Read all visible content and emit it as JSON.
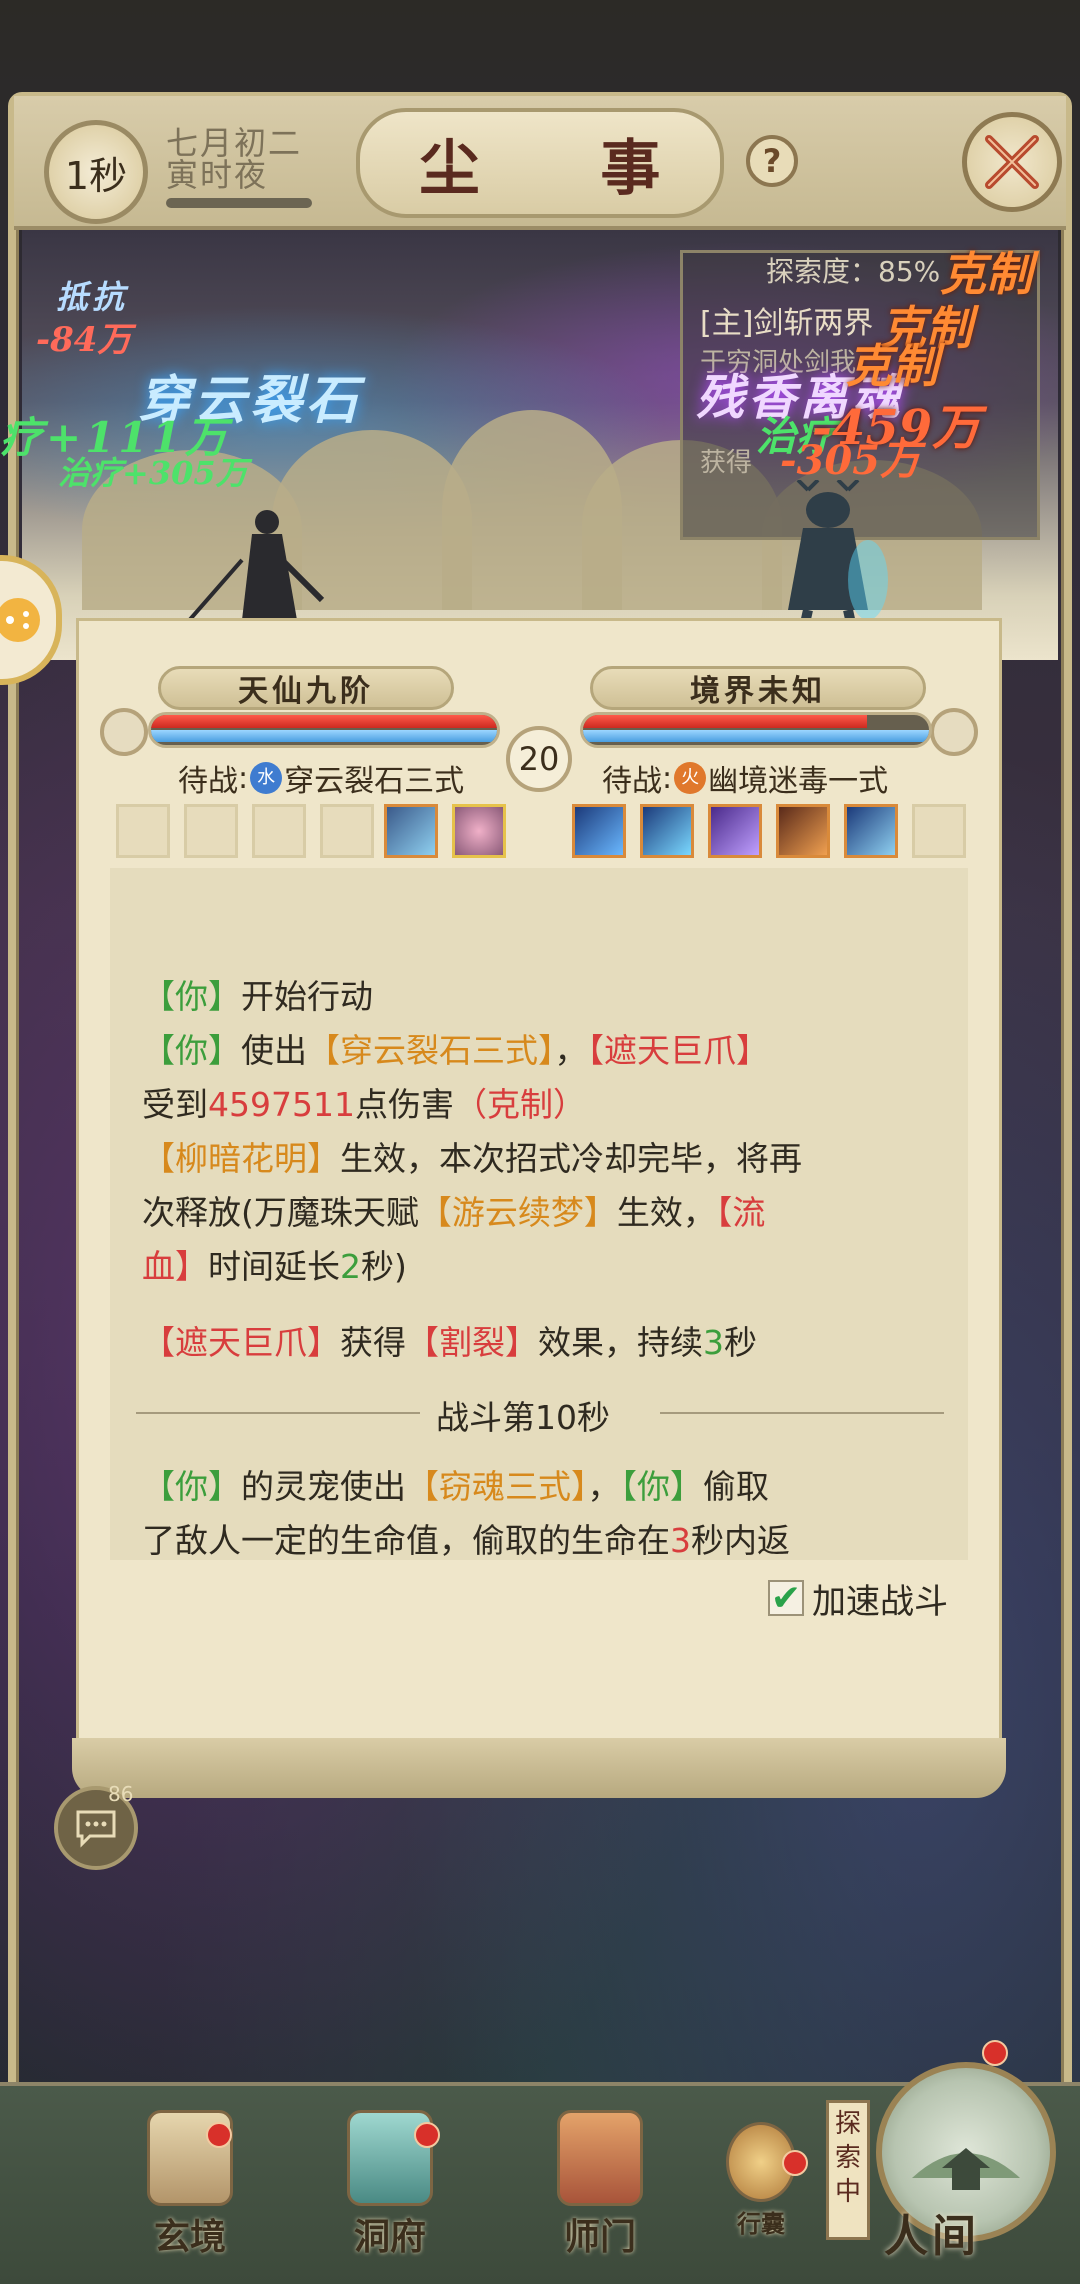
{
  "header": {
    "time_badge": "1秒",
    "date_line1": "七月初二",
    "date_line2": "寅时夜",
    "title": "尘 事",
    "help_label": "?"
  },
  "explore": {
    "progress": "探索度：85%",
    "line1": "[主]剑斩两界",
    "line2": "于穷洞处剑我",
    "line3": "获得"
  },
  "combat_text": {
    "resist_label": "抵抗",
    "resist_value": "-84万",
    "heal_big": "疗+111万",
    "heal_small": "治疗+305万",
    "skill_left": "穿云裂石",
    "skill_right": "残香离魂",
    "counter_1": "克制",
    "counter_2": "克制",
    "counter_3": "克制",
    "dmg_right": "-459万",
    "heal_right": "治疗",
    "heal_right2": "-305万"
  },
  "player": {
    "name": "天仙九阶",
    "hp": 1.0,
    "mp": 1.0,
    "pending_label": "待战",
    "element": "水",
    "pending_skill": "穿云裂石三式"
  },
  "enemy": {
    "name": "境界未知",
    "hp": 0.82,
    "mp": 1.0,
    "pending_label": "待战",
    "element": "火",
    "pending_skill": "幽境迷毒一式"
  },
  "turn_counter": "20",
  "log": {
    "l1_a": "【你】",
    "l1_b": "开始行动",
    "l2_a": "【你】",
    "l2_b": "使出",
    "l2_c": "【穿云裂石三式】",
    "l2_d": "，",
    "l2_e": "【遮天巨爪】",
    "l3_a": "受到",
    "l3_b": "4597511",
    "l3_c": "点伤害",
    "l3_d": "（克制）",
    "l4_a": "【柳暗花明】",
    "l4_b": "生效，本次招式冷却完毕，将再",
    "l5_a": "次释放(万魔珠天赋",
    "l5_b": "【游云续梦】",
    "l5_c": "生效，",
    "l5_d": "【流",
    "l6_a": "血】",
    "l6_b": "时间延长",
    "l6_c": "2",
    "l6_d": "秒)",
    "l7_a": "【遮天巨爪】",
    "l7_b": "获得",
    "l7_c": "【割裂】",
    "l7_d": "效果，持续",
    "l7_e": "3",
    "l7_f": "秒",
    "divider": "战斗第10秒",
    "l8_a": "【你】",
    "l8_b": "的灵宠使出",
    "l8_c": "【窃魂三式】",
    "l8_d": "，",
    "l8_e": "【你】",
    "l8_f": "偷取",
    "l9_a": "了敌人一定的生命值，偷取的生命在",
    "l9_b": "3",
    "l9_c": "秒内返"
  },
  "speed_battle": {
    "label": "加速战斗",
    "checked": true,
    "check_glyph": "✔"
  },
  "chat": {
    "count": "86",
    "icon": "chat-bubble-icon"
  },
  "nav": {
    "items": [
      {
        "label": "玄境"
      },
      {
        "label": "洞府"
      },
      {
        "label": "师门"
      },
      {
        "label": "行囊"
      }
    ],
    "explore_tag": "探索中",
    "world": "人间"
  },
  "colors": {
    "log_green": "#3c9e3c",
    "log_orange": "#d7891c",
    "log_red": "#d83d3d",
    "heal_green": "#4de26a",
    "damage_red": "#ff6a5a",
    "counter_orange": "#ff8a33"
  }
}
